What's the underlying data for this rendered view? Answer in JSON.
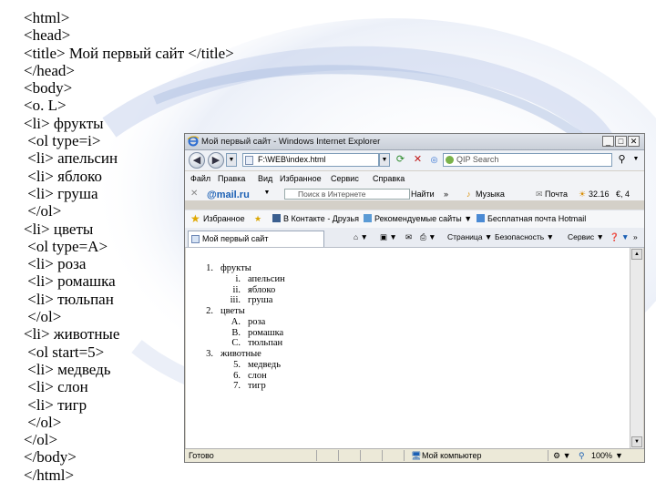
{
  "code_lines": [
    "<html>",
    "<head>",
    "<title> Мой первый сайт </title>",
    "</head>",
    "<body>",
    "<o. L>",
    "<li> фрукты",
    " <ol type=i>",
    " <li> апельсин",
    " <li> яблоко",
    " <li> груша",
    " </ol>",
    "<li> цветы",
    " <ol type=A>",
    " <li> роза",
    " <li> ромашка",
    " <li> тюльпан",
    " </ol>",
    "<li> животные",
    " <ol start=5>",
    " <li> медведь",
    " <li> слон",
    " <li> тигр",
    " </ol>",
    "</ol>",
    "</body>",
    "</html>"
  ],
  "browser": {
    "title": "Мой первый сайт - Windows Internet Explorer",
    "address": "F:\\WEB\\index.html",
    "search_placeholder": "QIP Search",
    "menu": [
      "Файл",
      "Правка",
      "Вид",
      "Избранное",
      "Сервис",
      "Справка"
    ],
    "mailru_logo": "@mail.ru",
    "mail_search_placeholder": "Поиск в Интернете",
    "find_label": "Найти",
    "chevron": "»",
    "music_label": "Музыка",
    "mail_label": "Почта",
    "weather": "32.16",
    "currency": "€, 4",
    "favorites_label": "Избранное",
    "fav_links": [
      "В Контакте - Друзья",
      "Рекомендуемые сайты",
      "Бесплатная почта Hotmail"
    ],
    "tab_title": "Мой первый сайт",
    "tab_tools": [
      "Страница",
      "Безопасность",
      "Сервис"
    ],
    "status_text": "Готово",
    "status_zone": "Мой компьютер",
    "zoom": "100%"
  },
  "rendered_list": [
    {
      "marker": "1.",
      "text": "фрукты",
      "children": [
        {
          "marker": "i.",
          "text": "апельсин"
        },
        {
          "marker": "ii.",
          "text": "яблоко"
        },
        {
          "marker": "iii.",
          "text": "груша"
        }
      ]
    },
    {
      "marker": "2.",
      "text": "цветы",
      "children": [
        {
          "marker": "A.",
          "text": "роза"
        },
        {
          "marker": "B.",
          "text": "ромашка"
        },
        {
          "marker": "C.",
          "text": "тюльпан"
        }
      ]
    },
    {
      "marker": "3.",
      "text": "животные",
      "children": [
        {
          "marker": "5.",
          "text": "медведь"
        },
        {
          "marker": "6.",
          "text": "слон"
        },
        {
          "marker": "7.",
          "text": "тигр"
        }
      ]
    }
  ],
  "colors": {
    "swirl": "#b8c6e3",
    "mailru_blue": "#1a5fb4",
    "mailru_orange": "#f08c00"
  }
}
